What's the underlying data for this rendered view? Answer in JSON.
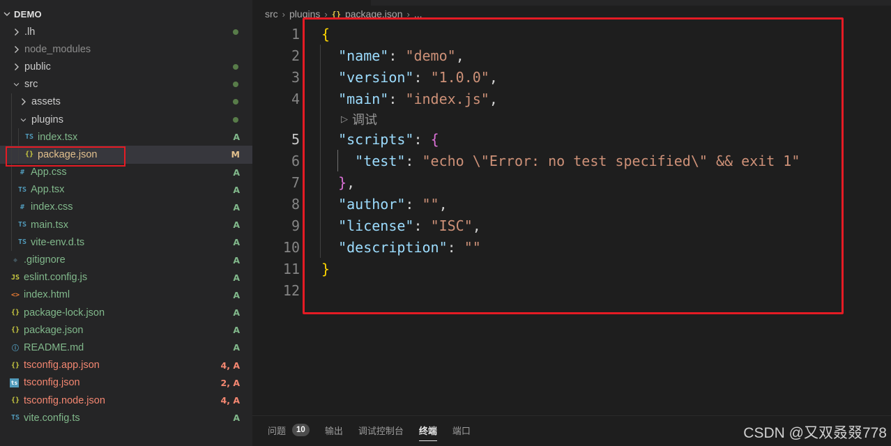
{
  "explorer": {
    "root_label": "DEMO",
    "items": [
      {
        "name": ".lh",
        "kind": "folder",
        "open": false,
        "depth": 0,
        "status": "dot",
        "color": "default"
      },
      {
        "name": "node_modules",
        "kind": "folder",
        "open": false,
        "depth": 0,
        "status": "",
        "color": "ignored"
      },
      {
        "name": "public",
        "kind": "folder",
        "open": false,
        "depth": 0,
        "status": "dot",
        "color": "default"
      },
      {
        "name": "src",
        "kind": "folder",
        "open": true,
        "depth": 0,
        "status": "dot",
        "color": "default"
      },
      {
        "name": "assets",
        "kind": "folder",
        "open": false,
        "depth": 1,
        "status": "dot",
        "color": "default"
      },
      {
        "name": "plugins",
        "kind": "folder",
        "open": true,
        "depth": 1,
        "status": "dot",
        "color": "default"
      },
      {
        "name": "index.tsx",
        "kind": "file",
        "icon": "ts",
        "depth": 2,
        "status": "A",
        "color": "added"
      },
      {
        "name": "package.json",
        "kind": "file",
        "icon": "json",
        "depth": 2,
        "status": "M",
        "color": "modified",
        "selected": true
      },
      {
        "name": "App.css",
        "kind": "file",
        "icon": "css",
        "depth": 1,
        "status": "A",
        "color": "added"
      },
      {
        "name": "App.tsx",
        "kind": "file",
        "icon": "ts",
        "depth": 1,
        "status": "A",
        "color": "added"
      },
      {
        "name": "index.css",
        "kind": "file",
        "icon": "css",
        "depth": 1,
        "status": "A",
        "color": "added"
      },
      {
        "name": "main.tsx",
        "kind": "file",
        "icon": "ts",
        "depth": 1,
        "status": "A",
        "color": "added"
      },
      {
        "name": "vite-env.d.ts",
        "kind": "file",
        "icon": "ts",
        "depth": 1,
        "status": "A",
        "color": "added"
      },
      {
        "name": ".gitignore",
        "kind": "file",
        "icon": "git",
        "depth": 0,
        "status": "A",
        "color": "added"
      },
      {
        "name": "eslint.config.js",
        "kind": "file",
        "icon": "js",
        "depth": 0,
        "status": "A",
        "color": "added"
      },
      {
        "name": "index.html",
        "kind": "file",
        "icon": "html",
        "depth": 0,
        "status": "A",
        "color": "added"
      },
      {
        "name": "package-lock.json",
        "kind": "file",
        "icon": "json",
        "depth": 0,
        "status": "A",
        "color": "added"
      },
      {
        "name": "package.json",
        "kind": "file",
        "icon": "json",
        "depth": 0,
        "status": "A",
        "color": "added"
      },
      {
        "name": "README.md",
        "kind": "file",
        "icon": "info",
        "depth": 0,
        "status": "A",
        "color": "added"
      },
      {
        "name": "tsconfig.app.json",
        "kind": "file",
        "icon": "json",
        "depth": 0,
        "status": "4, A",
        "color": "error"
      },
      {
        "name": "tsconfig.json",
        "kind": "file",
        "icon": "tsconfig",
        "depth": 0,
        "status": "2, A",
        "color": "error"
      },
      {
        "name": "tsconfig.node.json",
        "kind": "file",
        "icon": "json",
        "depth": 0,
        "status": "4, A",
        "color": "error"
      },
      {
        "name": "vite.config.ts",
        "kind": "file",
        "icon": "ts",
        "depth": 0,
        "status": "A",
        "color": "added"
      }
    ]
  },
  "breadcrumb": {
    "parts": [
      "src",
      "plugins",
      "package.json",
      "..."
    ]
  },
  "editor": {
    "lines": [
      {
        "n": "1",
        "tokens": [
          [
            "b1",
            "{"
          ]
        ]
      },
      {
        "n": "2",
        "tokens": [
          [
            "p",
            "  "
          ],
          [
            "k",
            "\"name\""
          ],
          [
            "p",
            ": "
          ],
          [
            "s",
            "\"demo\""
          ],
          [
            "p",
            ","
          ]
        ]
      },
      {
        "n": "3",
        "tokens": [
          [
            "p",
            "  "
          ],
          [
            "k",
            "\"version\""
          ],
          [
            "p",
            ": "
          ],
          [
            "s",
            "\"1.0.0\""
          ],
          [
            "p",
            ","
          ]
        ]
      },
      {
        "n": "4",
        "tokens": [
          [
            "p",
            "  "
          ],
          [
            "k",
            "\"main\""
          ],
          [
            "p",
            ": "
          ],
          [
            "s",
            "\"index.js\""
          ],
          [
            "p",
            ","
          ]
        ]
      },
      {
        "lens": "调试"
      },
      {
        "n": "5",
        "active": true,
        "tokens": [
          [
            "p",
            "  "
          ],
          [
            "k",
            "\"scripts\""
          ],
          [
            "p",
            ": "
          ],
          [
            "b2",
            "{"
          ]
        ]
      },
      {
        "n": "6",
        "guide2": true,
        "tokens": [
          [
            "p",
            "    "
          ],
          [
            "k",
            "\"test\""
          ],
          [
            "p",
            ": "
          ],
          [
            "s",
            "\"echo \\\"Error: no test specified\\\" && exit 1\""
          ]
        ]
      },
      {
        "n": "7",
        "tokens": [
          [
            "p",
            "  "
          ],
          [
            "b2",
            "}"
          ],
          [
            "p",
            ","
          ]
        ]
      },
      {
        "n": "8",
        "tokens": [
          [
            "p",
            "  "
          ],
          [
            "k",
            "\"author\""
          ],
          [
            "p",
            ": "
          ],
          [
            "s",
            "\"\""
          ],
          [
            "p",
            ","
          ]
        ]
      },
      {
        "n": "9",
        "tokens": [
          [
            "p",
            "  "
          ],
          [
            "k",
            "\"license\""
          ],
          [
            "p",
            ": "
          ],
          [
            "s",
            "\"ISC\""
          ],
          [
            "p",
            ","
          ]
        ]
      },
      {
        "n": "10",
        "tokens": [
          [
            "p",
            "  "
          ],
          [
            "k",
            "\"description\""
          ],
          [
            "p",
            ": "
          ],
          [
            "s",
            "\"\""
          ]
        ]
      },
      {
        "n": "11",
        "tokens": [
          [
            "b1",
            "}"
          ]
        ]
      },
      {
        "n": "12",
        "tokens": []
      }
    ]
  },
  "panel": {
    "tabs": [
      {
        "label": "问题",
        "badge": "10",
        "active": false
      },
      {
        "label": "输出",
        "active": false
      },
      {
        "label": "调试控制台",
        "active": false
      },
      {
        "label": "终端",
        "active": true
      },
      {
        "label": "端口",
        "active": false
      }
    ],
    "watermark": "CSDN @又双叒叕778"
  },
  "colors": {
    "added": "#81b88b",
    "modified": "#e2c08d",
    "error": "#f48771",
    "annotation_box": "#e51b24",
    "json_key": "#9cdcfe",
    "json_string": "#ce9178"
  }
}
